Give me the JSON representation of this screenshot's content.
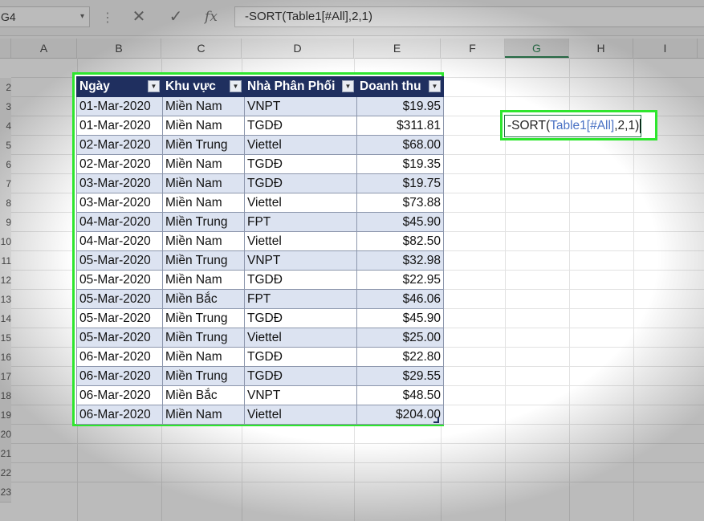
{
  "formula_bar": {
    "name_box": "G4",
    "name_box_arrow": "▾",
    "dots": "⋮",
    "cancel_glyph": "✕",
    "enter_glyph": "✓",
    "fx_glyph": "fx",
    "formula": "-SORT(Table1[#All],2,1)"
  },
  "columns": [
    "A",
    "B",
    "C",
    "D",
    "E",
    "F",
    "G",
    "H",
    "I"
  ],
  "rows": [
    "2",
    "3",
    "4",
    "5",
    "6",
    "7",
    "8",
    "9",
    "10",
    "11",
    "12",
    "13",
    "14",
    "15",
    "16",
    "17",
    "18",
    "19",
    "20",
    "21",
    "22",
    "23"
  ],
  "table": {
    "headers": [
      "Ngày",
      "Khu vực",
      "Nhà Phân Phối",
      "Doanh thu"
    ],
    "filter_glyph": "▼",
    "rows": [
      [
        "01-Mar-2020",
        "Miền Nam",
        "VNPT",
        "$19.95"
      ],
      [
        "01-Mar-2020",
        "Miền Nam",
        "TGDĐ",
        "$311.81"
      ],
      [
        "02-Mar-2020",
        "Miền Trung",
        "Viettel",
        "$68.00"
      ],
      [
        "02-Mar-2020",
        "Miền Nam",
        "TGDĐ",
        "$19.35"
      ],
      [
        "03-Mar-2020",
        "Miền Nam",
        "TGDĐ",
        "$19.75"
      ],
      [
        "03-Mar-2020",
        "Miền Nam",
        "Viettel",
        "$73.88"
      ],
      [
        "04-Mar-2020",
        "Miền Trung",
        "FPT",
        "$45.90"
      ],
      [
        "04-Mar-2020",
        "Miền Nam",
        "Viettel",
        "$82.50"
      ],
      [
        "05-Mar-2020",
        "Miền Trung",
        "VNPT",
        "$32.98"
      ],
      [
        "05-Mar-2020",
        "Miền Nam",
        "TGDĐ",
        "$22.95"
      ],
      [
        "05-Mar-2020",
        "Miền Bắc",
        "FPT",
        "$46.06"
      ],
      [
        "05-Mar-2020",
        "Miền Trung",
        "TGDĐ",
        "$45.90"
      ],
      [
        "05-Mar-2020",
        "Miền Trung",
        "Viettel",
        "$25.00"
      ],
      [
        "06-Mar-2020",
        "Miền Nam",
        "TGDĐ",
        "$22.80"
      ],
      [
        "06-Mar-2020",
        "Miền Trung",
        "TGDĐ",
        "$29.55"
      ],
      [
        "06-Mar-2020",
        "Miền Bắc",
        "VNPT",
        "$48.50"
      ],
      [
        "06-Mar-2020",
        "Miền Nam",
        "Viettel",
        "$204.00"
      ]
    ]
  },
  "cell_edit": {
    "prefix": "-SORT(",
    "reference": "Table1[#All]",
    "suffix": ",2,1)"
  },
  "colors": {
    "highlight": "#2ee62e",
    "header_fill": "#1f2f5f",
    "band_fill": "#dce3f1",
    "excel_green": "#217346"
  }
}
